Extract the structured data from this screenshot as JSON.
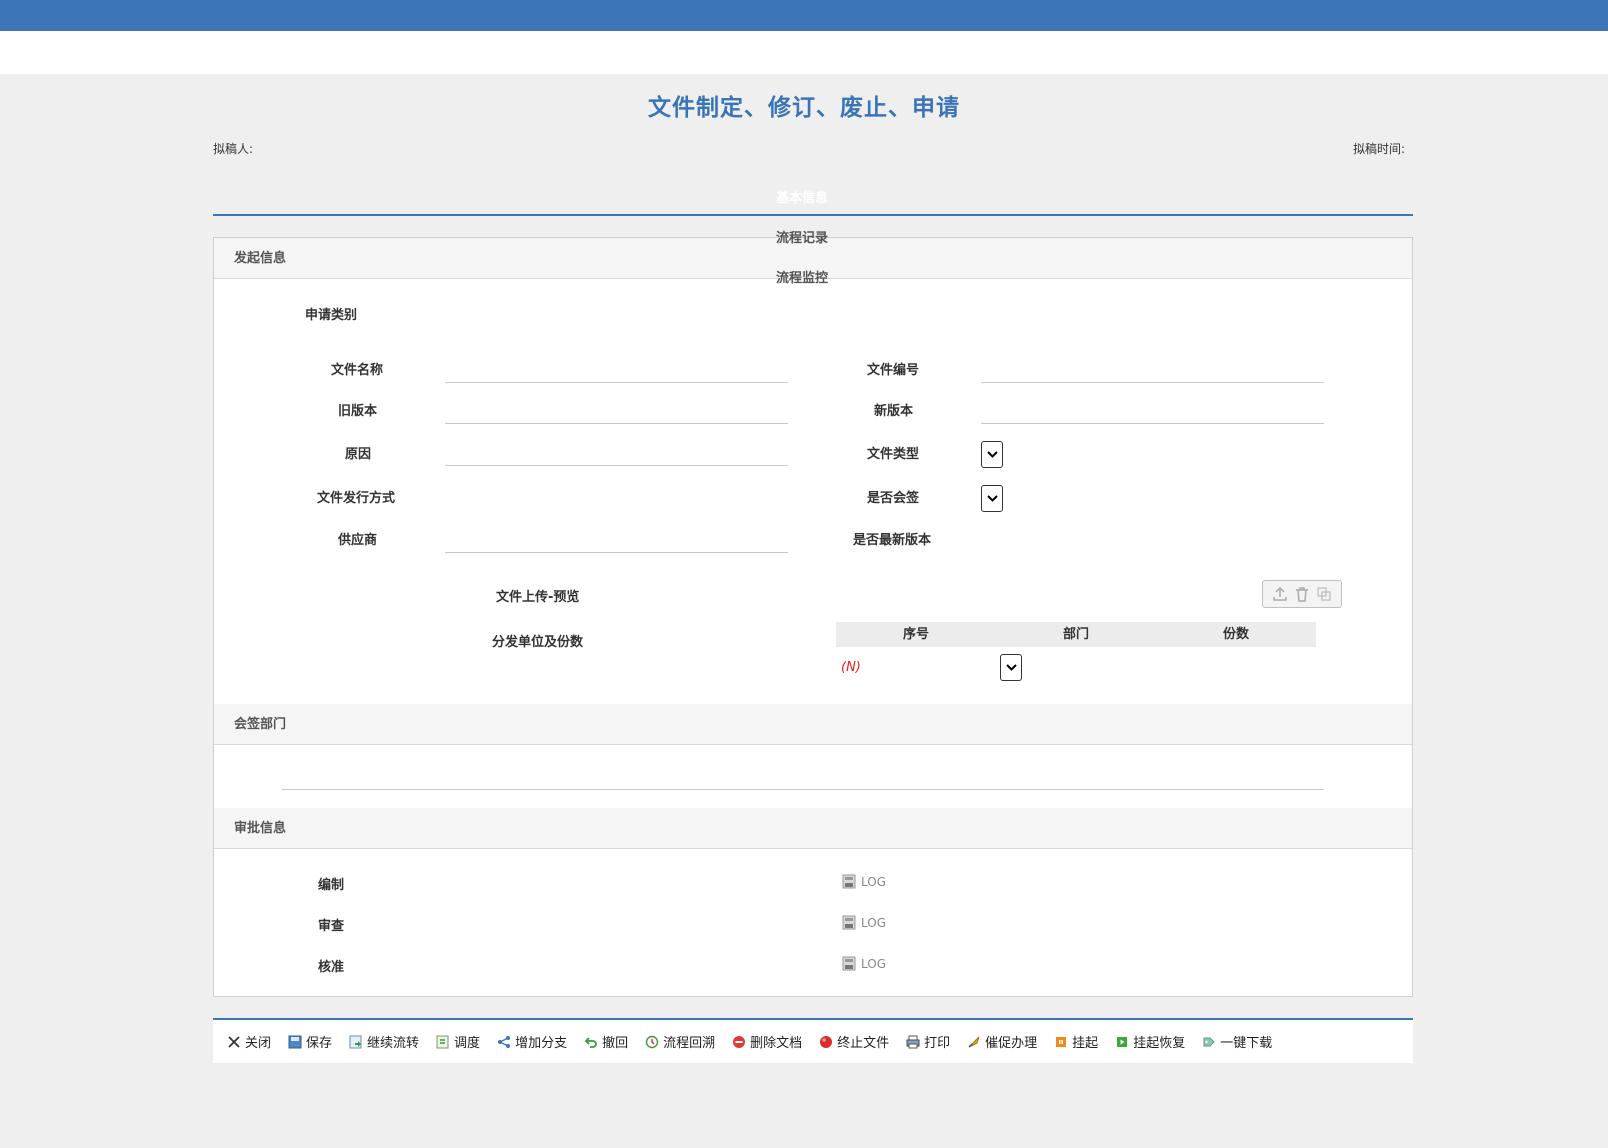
{
  "page_title": "文件制定、修订、废止、申请",
  "meta": {
    "drafter_label": "拟稿人:",
    "draft_time_label": "拟稿时间:"
  },
  "tabs": [
    {
      "label": "基本信息"
    },
    {
      "label": "流程记录"
    },
    {
      "label": "流程监控"
    }
  ],
  "sections": {
    "initiate": "发起信息",
    "countersign": "会签部门",
    "approval": "审批信息"
  },
  "form": {
    "apply_type": "申请类别",
    "file_name": "文件名称",
    "file_no": "文件编号",
    "old_version": "旧版本",
    "new_version": "新版本",
    "reason": "原因",
    "file_type": "文件类型",
    "issue_method": "文件发行方式",
    "is_countersign": "是否会签",
    "supplier": "供应商",
    "is_latest": "是否最新版本",
    "upload_preview": "文件上传-预览",
    "distribution": "分发单位及份数"
  },
  "distribution_table": {
    "columns": [
      "序号",
      "部门",
      "份数"
    ],
    "new_row_mark": "(N)"
  },
  "approval_rows": [
    {
      "label": "编制",
      "log": "LOG"
    },
    {
      "label": "审查",
      "log": "LOG"
    },
    {
      "label": "核准",
      "log": "LOG"
    }
  ],
  "toolbar": [
    {
      "icon": "close-icon",
      "label": "关闭"
    },
    {
      "icon": "save-icon",
      "label": "保存"
    },
    {
      "icon": "continue-flow-icon",
      "label": "继续流转"
    },
    {
      "icon": "dispatch-icon",
      "label": "调度"
    },
    {
      "icon": "add-branch-icon",
      "label": "增加分支"
    },
    {
      "icon": "withdraw-icon",
      "label": "撤回"
    },
    {
      "icon": "flow-rollback-icon",
      "label": "流程回溯"
    },
    {
      "icon": "delete-doc-icon",
      "label": "删除文档"
    },
    {
      "icon": "terminate-icon",
      "label": "终止文件"
    },
    {
      "icon": "print-icon",
      "label": "打印"
    },
    {
      "icon": "urge-icon",
      "label": "催促办理"
    },
    {
      "icon": "suspend-icon",
      "label": "挂起"
    },
    {
      "icon": "resume-icon",
      "label": "挂起恢复"
    },
    {
      "icon": "download-icon",
      "label": "一键下载"
    }
  ],
  "colors": {
    "primary": "#3c76b6",
    "title": "#3a74b8",
    "new_row_mark": "#e0201e"
  }
}
